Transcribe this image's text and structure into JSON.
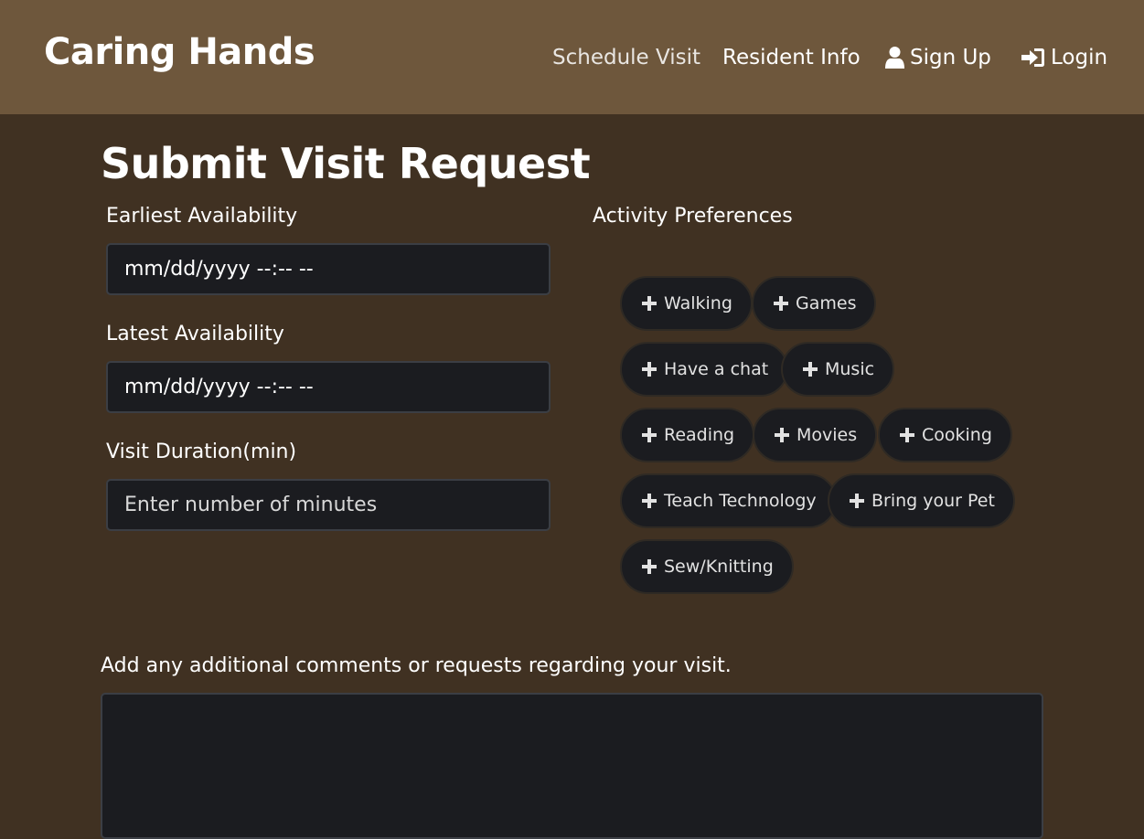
{
  "nav": {
    "brand": "Caring Hands",
    "schedule_visit": "Schedule Visit",
    "resident_info": "Resident Info",
    "sign_up": "Sign Up",
    "login": "Login"
  },
  "page": {
    "title": "Submit Visit Request"
  },
  "form": {
    "earliest_label": "Earliest Availability",
    "earliest_value": "mm/dd/yyyy --:-- --",
    "latest_label": "Latest Availability",
    "latest_value": "mm/dd/yyyy --:-- --",
    "duration_label": "Visit Duration(min)",
    "duration_placeholder": "Enter number of minutes",
    "activity_label": "Activity Preferences",
    "comments_label": "Add any additional comments or requests regarding your visit."
  },
  "activities": [
    "Walking",
    "Games",
    "Have a chat",
    "Music",
    "Reading",
    "Movies",
    "Cooking",
    "Teach Technology",
    "Bring your Pet",
    "Sew/Knitting"
  ],
  "icons": {
    "sign_up": "user-icon",
    "login": "sign-in-icon",
    "activity": "plus-icon"
  },
  "colors": {
    "navbar": "#6e573c",
    "background": "#403122",
    "field": "#1b1c20"
  }
}
